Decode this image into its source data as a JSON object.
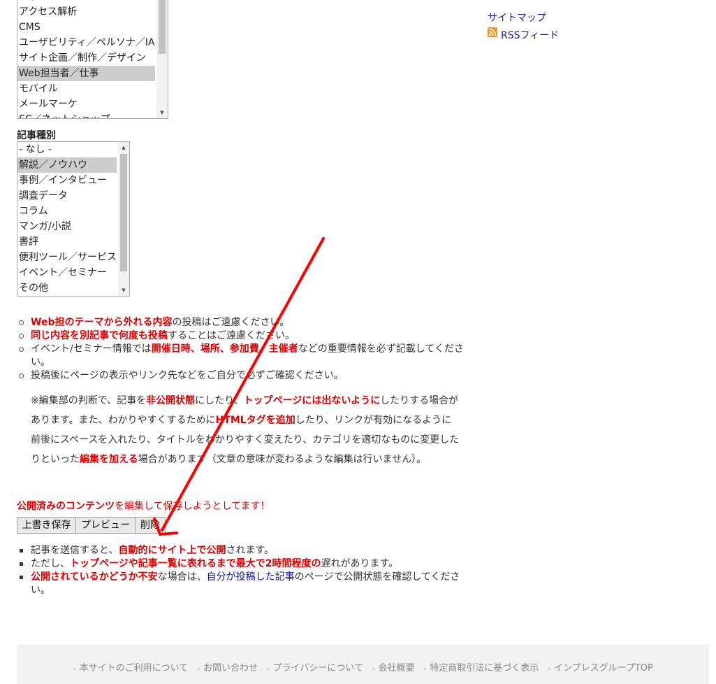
{
  "category_list": {
    "items": [
      "アクセス解析",
      "CMS",
      "ユーザビリティ／ペルソナ／IA",
      "サイト企画／制作／デザイン",
      "Web担当者／仕事",
      "モバイル",
      "メールマーケ",
      "EC／ネットショップ"
    ],
    "selected": "Web担当者／仕事"
  },
  "article_type": {
    "label": "記事種別",
    "items": [
      "- なし -",
      "解説／ノウハウ",
      "事例／インタビュー",
      "調査データ",
      "コラム",
      "マンガ/小説",
      "書評",
      "便利ツール／サービス",
      "イベント／セミナー",
      "その他"
    ],
    "selected": "解説／ノウハウ"
  },
  "sidebar": {
    "sitemap": "サイトマップ",
    "rss": "RSSフィード"
  },
  "notes": {
    "n1_red": "Web担のテーマから外れる内容",
    "n1_rest": "の投稿はご遠慮ください。",
    "n2_red": "同じ内容を別記事で何度も投稿",
    "n2_rest": "することはご遠慮ください。",
    "n3_a": "イベント/セミナー情報では",
    "n3_red": "開催日時、場所、参加費、主催者",
    "n3_b": "などの重要情報を必ず記載してくださ",
    "n3_c": "い。",
    "n4": "投稿後にページの表示やリンク先などをご自分で必ずご確認ください。"
  },
  "editorial": {
    "l1_a": "※編集部の判断で、記事を",
    "l1_red1": "非公開状態",
    "l1_b": "にしたり、",
    "l1_red2": "トップページには出ないように",
    "l1_c": "したりする場合が",
    "l2_a": "あります。また、わかりやすくするために",
    "l2_red": "HTMLタグを追加",
    "l2_b": "したり、リンクが有効になるように",
    "l3": "前後にスペースを入れたり、タイトルをわかりやすく変えたり、カテゴリを適切なものに変更した",
    "l4_a": "りといった",
    "l4_red": "編集を加える",
    "l4_b": "場合があります（文章の意味が変わるような編集は行いません）。"
  },
  "warning": {
    "red": "公開済みのコンテンツ",
    "rest": "を編集して保存しようとしてます！"
  },
  "buttons": {
    "overwrite": "上書き保存",
    "preview": "プレビュー",
    "delete": "削除"
  },
  "post_notes": {
    "p1_a": "記事を送信すると、",
    "p1_red": "自動的にサイト上で公開",
    "p1_b": "されます。",
    "p2_a": "ただし、",
    "p2_red": "トップページや記事一覧に表れるまで最大で2時間程度の",
    "p2_b": "遅れがあります。",
    "p3_red": "公開されているかどうか不安",
    "p3_a": "な場合は、",
    "p3_link": "自分が投稿した記事",
    "p3_b": "のページで公開状態を確認してくださ",
    "p3_c": "い。"
  },
  "footer": {
    "links": [
      "本サイトのご利用について",
      "お問い合わせ",
      "プライバシーについて",
      "会社概要",
      "特定商取引法に基づく表示",
      "インプレスグループTOP"
    ]
  },
  "colors": {
    "accent_red": "#e00000",
    "link_blue": "#1a1aa6",
    "annotation_arrow": "#ff0000"
  }
}
